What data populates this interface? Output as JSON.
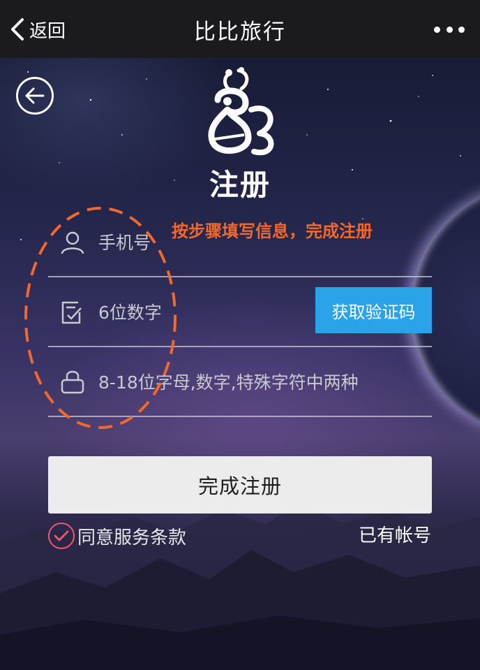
{
  "navbar": {
    "back_label": "返回",
    "title": "比比旅行",
    "more_icon": "more-dots-icon"
  },
  "page": {
    "back_icon": "circle-arrow-left-icon",
    "logo_icon": "bee-logo-icon",
    "heading": "注册",
    "hint": "按步骤填写信息，完成注册"
  },
  "form": {
    "phone": {
      "icon": "user-icon",
      "placeholder": "手机号",
      "value": ""
    },
    "code": {
      "icon": "checklist-icon",
      "placeholder": "6位数字",
      "value": ""
    },
    "password": {
      "icon": "lock-icon",
      "placeholder": "8-18位字母,数字,特殊字符中两种",
      "value": ""
    },
    "get_code_label": "获取验证码",
    "submit_label": "完成注册"
  },
  "footer": {
    "agree_label": "同意服务条款",
    "agree_checked": true,
    "login_label": "已有帐号"
  },
  "colors": {
    "navbar_bg": "#1b1b1d",
    "hint": "#f3682c",
    "code_button": "#2aa3e8",
    "submit_button": "#ececec",
    "agree_check": "#f0586e",
    "annotation": "#f3682c"
  }
}
